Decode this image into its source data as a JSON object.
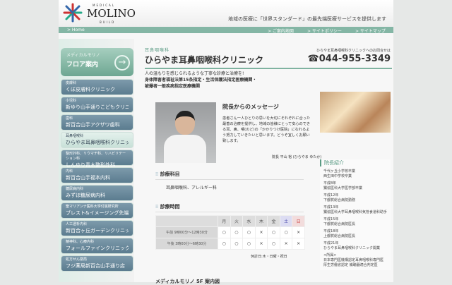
{
  "header": {
    "logo_top": "MEDICAL",
    "logo_name": "MOLINO",
    "logo_bottom": "BUILD",
    "tagline": "地域の医療に「世界スタンダード」の最先端医療サービスを提供します"
  },
  "nav": {
    "home": "> Home",
    "links": [
      "> ご案内地図",
      "> サイトポリシー",
      "> サイトマップ"
    ]
  },
  "sidebar": {
    "floor_sub": "メディカルモリノ",
    "floor_title": "フロア案内",
    "items": [
      {
        "cat": "皮膚科",
        "name": "くぼ皮膚科クリニック"
      },
      {
        "cat": "小児科",
        "name": "新ゆり山手通りこどもクリニック"
      },
      {
        "cat": "歯科",
        "name": "新百合山手アクザワ歯科"
      },
      {
        "cat": "耳鼻咽喉科",
        "name": "ひらやま耳鼻咽喉科クリニック"
      },
      {
        "cat": "整形外科、リウマチ科、リハビリテーション科",
        "name": "しんゆり青木整形外科"
      },
      {
        "cat": "内科",
        "name": "新百合山手福本内科"
      },
      {
        "cat": "糖尿病内科",
        "name": "みずほ糖尿病内科"
      },
      {
        "cat": "聖マリアンナ医科大学付属研究所",
        "name": "ブレスト&イメージング先端医療センター"
      },
      {
        "cat": "人工透析内科",
        "name": "新百合ヶ丘ガーデンクリニック"
      },
      {
        "cat": "精神科、心療内科",
        "name": "フォールファインクリニック"
      },
      {
        "cat": "処方せん薬局",
        "name": "フジ薬局新百合山手通り店"
      }
    ]
  },
  "main": {
    "category": "耳鼻咽喉科",
    "title": "ひらやま耳鼻咽喉科クリニック",
    "inquiry": "ひらやま耳鼻咽喉科クリニックへのお問合せは",
    "phone": "044-955-3349",
    "intro": [
      "人の温もりを感じられるような丁寧な診療と治療を!",
      "身体障害者福祉法第15条指定・生活保護法指定医療機関・",
      "被爆者一般疾病指定医療機関"
    ],
    "message_title": "院長からのメッセージ",
    "message": "患者さん一人ひとりの思いを大切にそれぞれに合った最善の治療を提供し、地域の皆様にとって安心のできる耳、鼻、喉(のど)の「かかりつけ医院」になれるよう努力していきたいと思います。どうぞ宜しくお願い致します。",
    "signature": "院長 平山 裕 (ひらやま ゆたか)",
    "dept_heading": "診療科目",
    "depts": "耳鼻咽喉科、アレルギー科",
    "hours_heading": "診療時間",
    "days": [
      "月",
      "火",
      "水",
      "木",
      "金",
      "土",
      "日"
    ],
    "rows": [
      {
        "label": "午前 9時00分〜12時30分",
        "marks": [
          "○",
          "○",
          "○",
          "×",
          "○",
          "○",
          "×"
        ]
      },
      {
        "label": "午後 3時00分〜6時30分",
        "marks": [
          "○",
          "○",
          "○",
          "×",
          "○",
          "×",
          "×"
        ]
      }
    ],
    "closed": "休診日:木・日曜・祝日",
    "access_heading": "メディカルモリノ 5F 案内図"
  },
  "profile": {
    "title": "院長紹介",
    "entries": [
      "千代ヶ丘小学校卒業\n西生田中学校卒業",
      "平成8年\n獨協医科大学医学部卒業",
      "平成12年\n下都賀総合病院勤務",
      "平成13年\n獨協医科大学耳鼻咽喉科気管食道科助手",
      "平成15年\n下都賀総合病院医長",
      "平成18年\n上都賀総合病院医長",
      "平成21年\nひらやま耳鼻咽喉科クリニック開業",
      "<所属>\n日本専門医機構認定耳鼻咽喉科専門医\n厚生労働省認定 補聴器適合判定医"
    ]
  }
}
